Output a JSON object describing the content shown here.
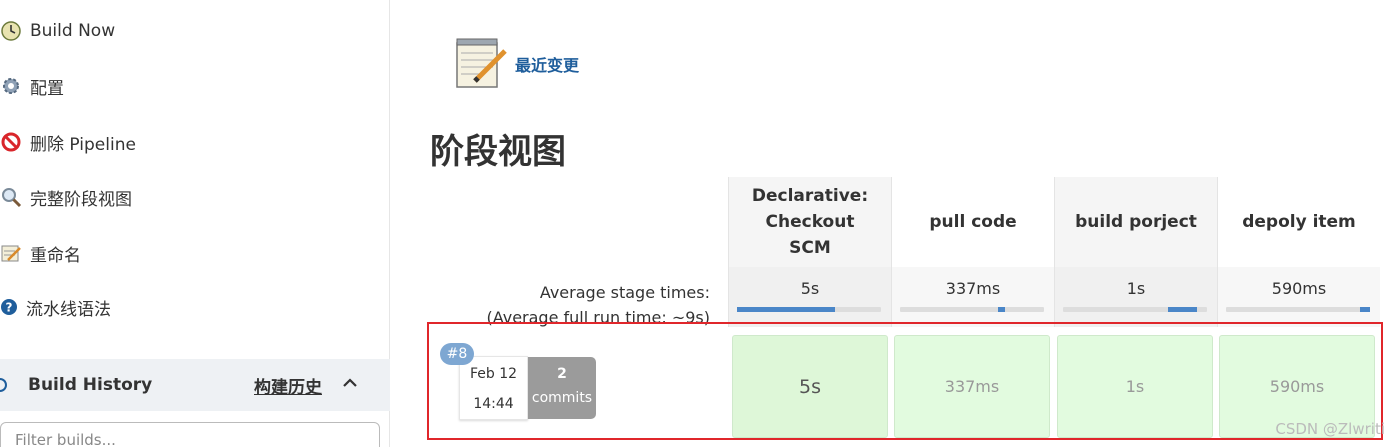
{
  "sidebar": {
    "tasks": [
      {
        "label": "Build Now",
        "icon": "clock-icon"
      },
      {
        "label": "配置",
        "icon": "gear-icon"
      },
      {
        "label": "删除 Pipeline",
        "icon": "no-entry-icon"
      },
      {
        "label": "完整阶段视图",
        "icon": "magnifier-icon"
      },
      {
        "label": "重命名",
        "icon": "notepad-icon"
      },
      {
        "label": "流水线语法",
        "icon": "help-icon"
      }
    ],
    "history": {
      "title": "Build History",
      "cn_label": "构建历史",
      "filter_placeholder": "Filter builds..."
    }
  },
  "main": {
    "changes_link": "最近变更",
    "title": "阶段视图",
    "avg_label_1": "Average stage times:",
    "avg_label_2": "(Average full run time: ~9s)",
    "stages": [
      {
        "name": "Declarative: Checkout SCM",
        "avg": "5s",
        "bar_fill": [
          0.0,
          0.68
        ],
        "run": "5s"
      },
      {
        "name": "pull code",
        "avg": "337ms",
        "bar_fill": [
          0.68,
          0.73
        ],
        "run": "337ms"
      },
      {
        "name": "build porject",
        "avg": "1s",
        "bar_fill": [
          0.73,
          0.93
        ],
        "run": "1s"
      },
      {
        "name": "depoly item",
        "avg": "590ms",
        "bar_fill": [
          0.93,
          1.0
        ],
        "run": "590ms"
      }
    ],
    "build": {
      "number": "#8",
      "date": "Feb 12",
      "time": "14:44",
      "commits_count": "2",
      "commits_label": "commits"
    }
  },
  "watermark": "CSDN @Zlwriti",
  "colors": {
    "accent_link": "#1f5e9c",
    "success_cell": "#e2fbdf",
    "highlight_frame": "#e0262b",
    "progress": "#4a86c8"
  }
}
